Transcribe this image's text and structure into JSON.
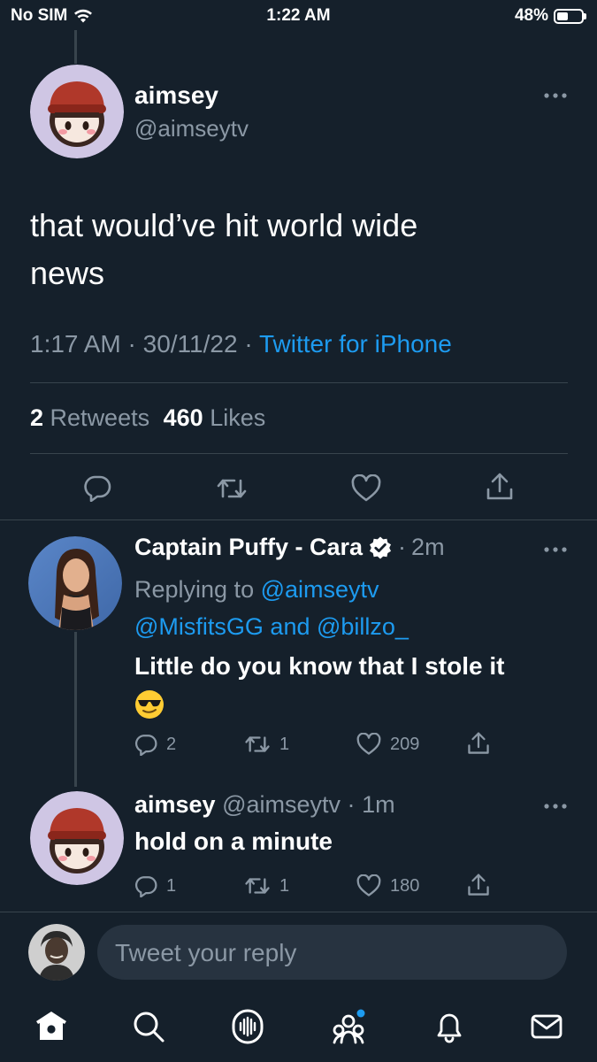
{
  "status_bar": {
    "carrier": "No SIM",
    "time": "1:22 AM",
    "battery": "48%",
    "battery_level": 0.48
  },
  "main_tweet": {
    "display_name": "aimsey",
    "handle": "@aimseytv",
    "text_line1": "that would’ve hit world wide",
    "text_line2": "news",
    "time": "1:17 AM",
    "date": "30/11/22",
    "sep": "·",
    "client": "Twitter for iPhone",
    "retweets_count": "2",
    "retweets_label": "Retweets",
    "likes_count": "460",
    "likes_label": "Likes"
  },
  "reply1": {
    "display_name": "Captain Puffy - Cara",
    "verified": true,
    "age": "2m",
    "sep": "·",
    "replying_prefix": "Replying to",
    "mention1": "@aimseytv",
    "mention2": "@MisfitsGG",
    "and_word": "and",
    "mention3": "@billzo_",
    "text": "Little do you know that I stole it",
    "emoji": "😎",
    "replies": "2",
    "retweets": "1",
    "likes": "209"
  },
  "reply2": {
    "display_name": "aimsey",
    "handle": "@aimseytv",
    "age": "1m",
    "sep": "·",
    "text": "hold on a minute",
    "replies": "1",
    "retweets": "1",
    "likes": "180"
  },
  "composer": {
    "placeholder": "Tweet your reply"
  },
  "tab_bar": [
    "home-icon",
    "search-icon",
    "spaces-icon",
    "communities-icon",
    "notifications-icon",
    "messages-icon"
  ],
  "colors": {
    "background": "#15202b",
    "accent": "#1d9bf0",
    "muted": "#8b98a5",
    "divider": "#38444d"
  }
}
